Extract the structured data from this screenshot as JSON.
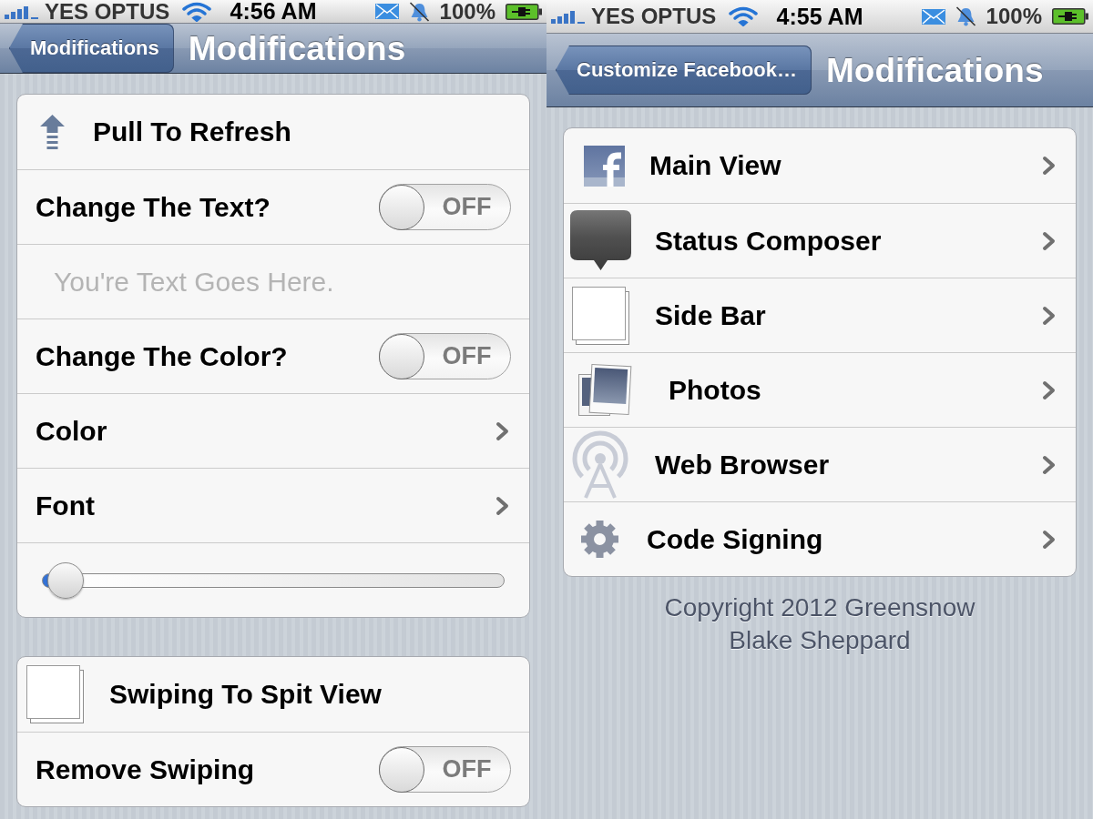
{
  "screens": [
    {
      "status_bar": {
        "carrier": "YES OPTUS",
        "time": "4:56 AM",
        "battery": "100%"
      },
      "nav_bar": {
        "back_button": "Modifications",
        "title": "Modifications"
      },
      "groups": [
        {
          "rows": [
            {
              "kind": "header",
              "label": "Pull To Refresh"
            },
            {
              "kind": "switch",
              "label": "Change The Text?",
              "on": false,
              "switch_text": "OFF"
            },
            {
              "kind": "field",
              "placeholder": "You're Text Goes Here."
            },
            {
              "kind": "switch",
              "label": "Change The Color?",
              "on": false,
              "switch_text": "OFF"
            },
            {
              "kind": "link",
              "label": "Color"
            },
            {
              "kind": "link",
              "label": "Font"
            },
            {
              "kind": "slider",
              "level": 0
            }
          ]
        },
        {
          "rows": [
            {
              "kind": "header",
              "label": "Swiping To Spit View"
            },
            {
              "kind": "switch",
              "label": "Remove Swiping",
              "on": false,
              "switch_text": "OFF"
            }
          ]
        }
      ]
    },
    {
      "status_bar": {
        "carrier": "YES OPTUS",
        "time": "4:55 AM",
        "battery": "100%"
      },
      "nav_bar": {
        "back_button": "Customize Facebook…",
        "title": "Modifications"
      },
      "groups": [
        {
          "rows": [
            {
              "kind": "link",
              "label": "Main View"
            },
            {
              "kind": "link",
              "label": "Status Composer"
            },
            {
              "kind": "link",
              "label": "Side Bar"
            },
            {
              "kind": "link",
              "label": "Photos"
            },
            {
              "kind": "link",
              "label": "Web Browser"
            },
            {
              "kind": "link",
              "label": "Code Signing"
            }
          ]
        }
      ],
      "footer": [
        "Copyright 2012 Greensnow",
        "Blake Sheppard"
      ]
    }
  ]
}
